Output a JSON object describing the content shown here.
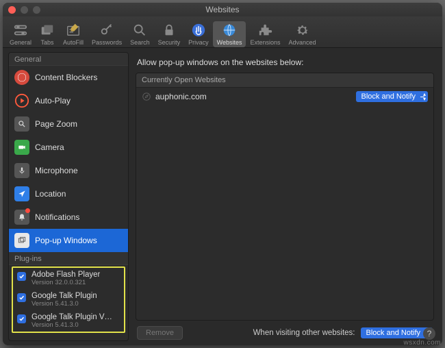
{
  "window": {
    "title": "Websites"
  },
  "toolbar": [
    {
      "name": "general",
      "label": "General"
    },
    {
      "name": "tabs",
      "label": "Tabs"
    },
    {
      "name": "autofill",
      "label": "AutoFill"
    },
    {
      "name": "passwords",
      "label": "Passwords"
    },
    {
      "name": "search",
      "label": "Search"
    },
    {
      "name": "security",
      "label": "Security"
    },
    {
      "name": "privacy",
      "label": "Privacy"
    },
    {
      "name": "websites",
      "label": "Websites",
      "selected": true
    },
    {
      "name": "extensions",
      "label": "Extensions"
    },
    {
      "name": "advanced",
      "label": "Advanced"
    }
  ],
  "sidebar": {
    "general_header": "General",
    "items": [
      {
        "name": "content-blockers",
        "label": "Content Blockers"
      },
      {
        "name": "auto-play",
        "label": "Auto-Play"
      },
      {
        "name": "page-zoom",
        "label": "Page Zoom"
      },
      {
        "name": "camera",
        "label": "Camera"
      },
      {
        "name": "microphone",
        "label": "Microphone"
      },
      {
        "name": "location",
        "label": "Location"
      },
      {
        "name": "notifications",
        "label": "Notifications",
        "badge": true
      },
      {
        "name": "popup-windows",
        "label": "Pop-up Windows",
        "selected": true
      }
    ],
    "plugins_header": "Plug-ins",
    "plugins": [
      {
        "name": "adobe-flash",
        "label": "Adobe Flash Player",
        "version": "Version 32.0.0.321",
        "checked": true
      },
      {
        "name": "google-talk",
        "label": "Google Talk Plugin",
        "version": "Version 5.41.3.0",
        "checked": true
      },
      {
        "name": "google-talk-vid",
        "label": "Google Talk Plugin Vid…",
        "version": "Version 5.41.3.0",
        "checked": true
      }
    ]
  },
  "main": {
    "heading": "Allow pop-up windows on the websites below:",
    "subheader": "Currently Open Websites",
    "rows": [
      {
        "site": "auphonic.com",
        "policy": "Block and Notify"
      }
    ],
    "remove_label": "Remove",
    "footer_label": "When visiting other websites:",
    "footer_policy": "Block and Notify"
  },
  "help_label": "?",
  "watermark": "wsxdn.com"
}
